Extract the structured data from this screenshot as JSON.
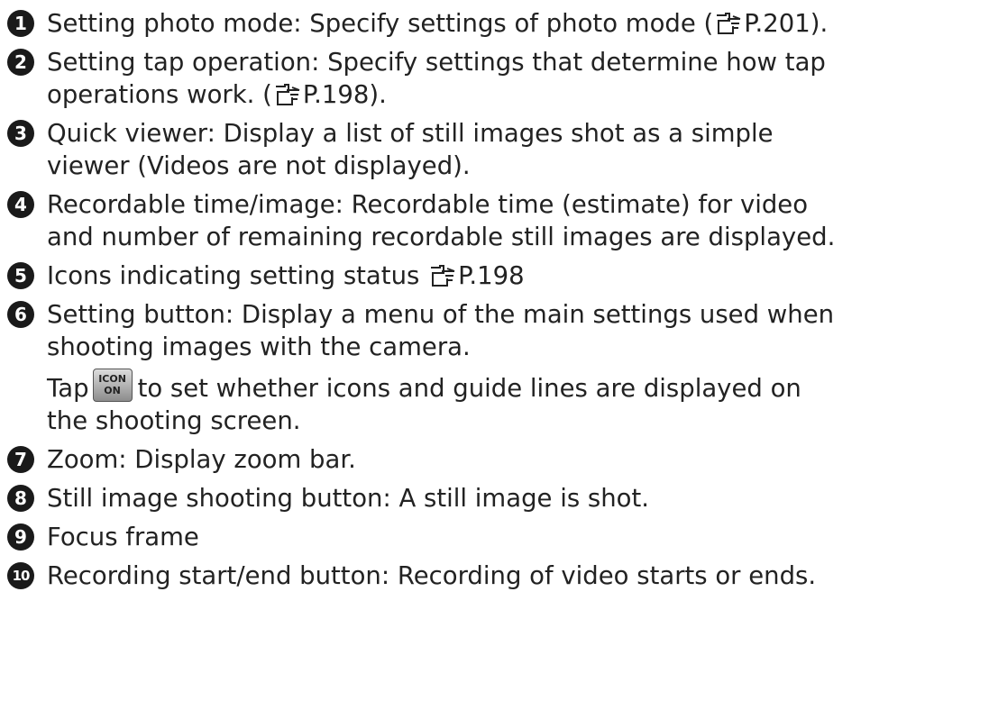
{
  "items": [
    {
      "number": "1",
      "text": "Setting photo mode: Specify settings of photo mode (",
      "ref": "P.201",
      "suffix": ")."
    },
    {
      "number": "2",
      "line1": "Setting tap operation: Specify settings that determine how tap",
      "line2_pre": "operations work. (",
      "ref": "P.198",
      "line2_post": ")."
    },
    {
      "number": "3",
      "line1": "Quick viewer: Display a list of still images shot as a simple",
      "line2": "viewer (Videos are not displayed)."
    },
    {
      "number": "4",
      "line1": "Recordable time/image: Recordable time (estimate) for video",
      "line2": "and number of remaining recordable still images are displayed."
    },
    {
      "number": "5",
      "text": "Icons indicating setting status ",
      "ref": "P.198"
    },
    {
      "number": "6",
      "line1": "Setting button: Display a menu of the main settings used when",
      "line2": "shooting images with the camera.",
      "sub_pre": "Tap",
      "badge_line1": "ICON",
      "badge_line2": "ON",
      "sub_post": "to set whether icons and guide lines are displayed on",
      "sub_line2": "the shooting screen."
    },
    {
      "number": "7",
      "text": "Zoom: Display zoom bar."
    },
    {
      "number": "8",
      "text": "Still image shooting button: A still image is shot."
    },
    {
      "number": "9",
      "text": "Focus frame"
    },
    {
      "number": "10",
      "text": "Recording start/end button: Recording of video starts or ends."
    }
  ],
  "icons": {
    "reference": "reference-hand-icon",
    "number_marker": "circled-number-icon"
  },
  "colors": {
    "text": "#222222",
    "marker_bg": "#1a1a1a",
    "marker_fg": "#ffffff"
  }
}
